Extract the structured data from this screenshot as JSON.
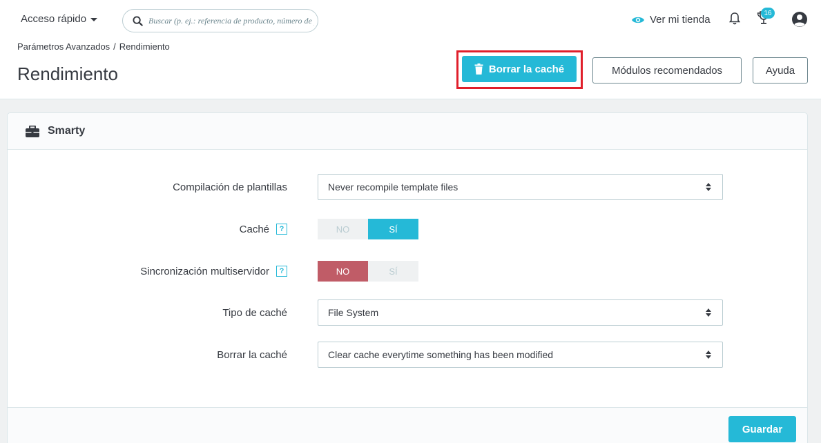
{
  "header": {
    "quick_access": "Acceso rápido",
    "search_placeholder": "Buscar (p. ej.: referencia de producto, número de pedido...)",
    "view_store": "Ver mi tienda",
    "orders_badge": "16",
    "icons": {
      "search": "search-icon",
      "eye": "eye-icon",
      "bell": "bell-icon",
      "orders": "trophy-icon",
      "user": "user-circle-icon"
    },
    "accent": "#25b9d7"
  },
  "breadcrumb": [
    "Parámetros Avanzados",
    "/",
    "Rendimiento"
  ],
  "page_title": "Rendimiento",
  "toolbar": {
    "clear_cache": "Borrar la caché",
    "modules": "Módulos recomendados",
    "help": "Ayuda",
    "highlight_color": "#e01f2b"
  },
  "panel": {
    "title": "Smarty",
    "icon": "briefcase-icon",
    "fields": {
      "template_compilation": {
        "label": "Compilación de plantillas",
        "value": "Never recompile template files"
      },
      "cache": {
        "label": "Caché",
        "help": "?",
        "no": "NO",
        "yes": "SÍ",
        "selected": "SÍ"
      },
      "multiserver": {
        "label": "Sincronización multiservidor",
        "help": "?",
        "no": "NO",
        "yes": "SÍ",
        "selected": "NO"
      },
      "cache_type": {
        "label": "Tipo de caché",
        "value": "File System"
      },
      "clear_cache": {
        "label": "Borrar la caché",
        "value": "Clear cache everytime something has been modified"
      }
    },
    "save": "Guardar"
  }
}
